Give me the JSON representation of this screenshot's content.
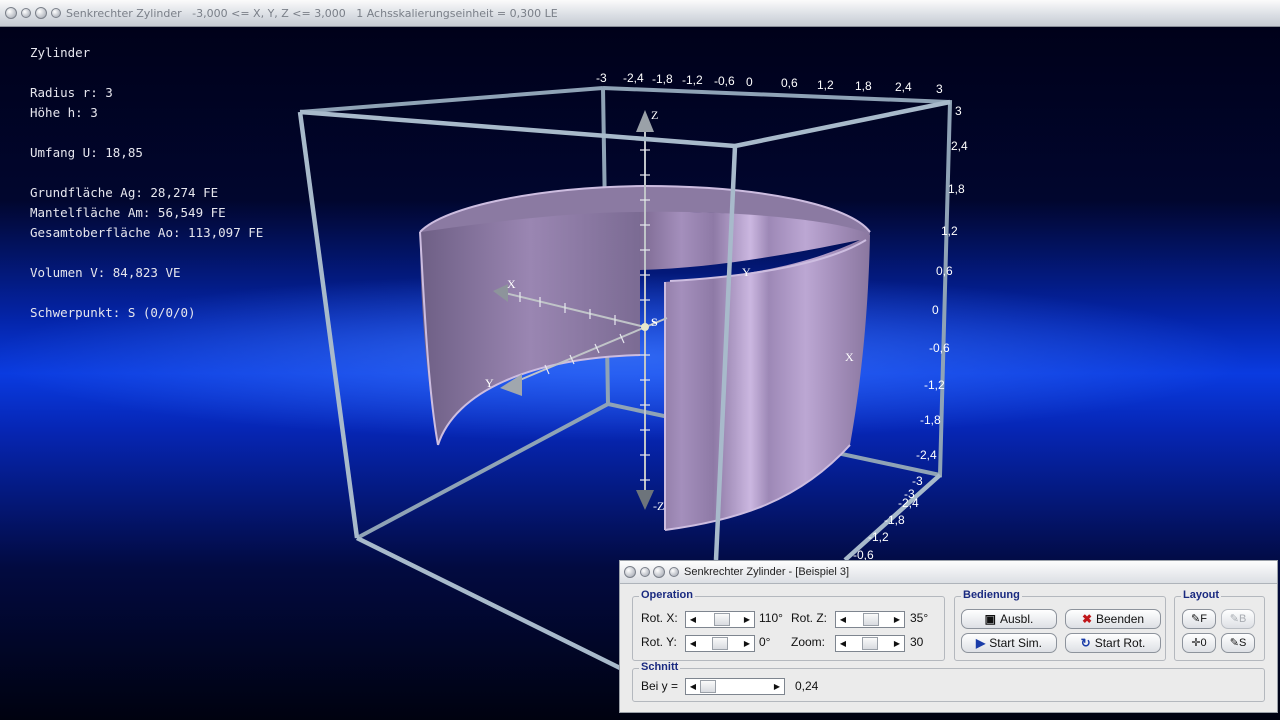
{
  "window": {
    "title": "Senkrechter Zylinder   -3,000 <= X, Y, Z <= 3,000   1 Achsskalierungseinheit = 0,300 LE"
  },
  "info": {
    "figure": "Zylinder",
    "radius": "Radius r: 3",
    "height": "Höhe h: 3",
    "circumference": "Umfang U: 18,85",
    "base_area": "Grundfläche Ag: 28,274 FE",
    "lateral_area": "Mantelfläche Am: 56,549 FE",
    "total_surface": "Gesamtoberfläche Ao: 113,097 FE",
    "volume": "Volumen V: 84,823 VE",
    "centroid": "Schwerpunkt: S (0/0/0)"
  },
  "scene": {
    "top_ticks": [
      "-3",
      "-2,4",
      "-1,8",
      "-1,2",
      "-0,6",
      "0",
      "0,6",
      "1,2",
      "1,8",
      "2,4",
      "3"
    ],
    "right_ticks": [
      "3",
      "2,4",
      "1,8",
      "1,2",
      "0,6",
      "0",
      "-0,6",
      "-1,2",
      "-1,8",
      "-2,4",
      "-3"
    ],
    "bottom_ticks": [
      "-3",
      "-2,4",
      "-1,8",
      "-1,2",
      "-0,6"
    ],
    "axis_labels": {
      "z": "Z",
      "neg_z": "-Z",
      "x": "X",
      "y": "Y",
      "x_far": "X",
      "y_far": "Y",
      "s": "S"
    },
    "colors": {
      "cylinder": "#b79fd0",
      "frame": "#9fb2c4",
      "background": "#0a3be0"
    }
  },
  "control": {
    "title": "Senkrechter Zylinder - [Beispiel 3]",
    "operation": {
      "label": "Operation",
      "rot_x_label": "Rot. X:",
      "rot_x_value": "110°",
      "rot_y_label": "Rot. Y:",
      "rot_y_value": "0°",
      "rot_z_label": "Rot. Z:",
      "rot_z_value": "35°",
      "zoom_label": "Zoom:",
      "zoom_value": "30"
    },
    "bedienung": {
      "label": "Bedienung",
      "ausbl": "Ausbl.",
      "beenden": "Beenden",
      "start_sim": "Start Sim.",
      "start_rot": "Start Rot."
    },
    "layout": {
      "label": "Layout",
      "f": "F",
      "b": "B",
      "o": "0",
      "s": "S"
    },
    "schnitt": {
      "label": "Schnitt",
      "bei_y": "Bei y =",
      "value": "0,24"
    }
  }
}
